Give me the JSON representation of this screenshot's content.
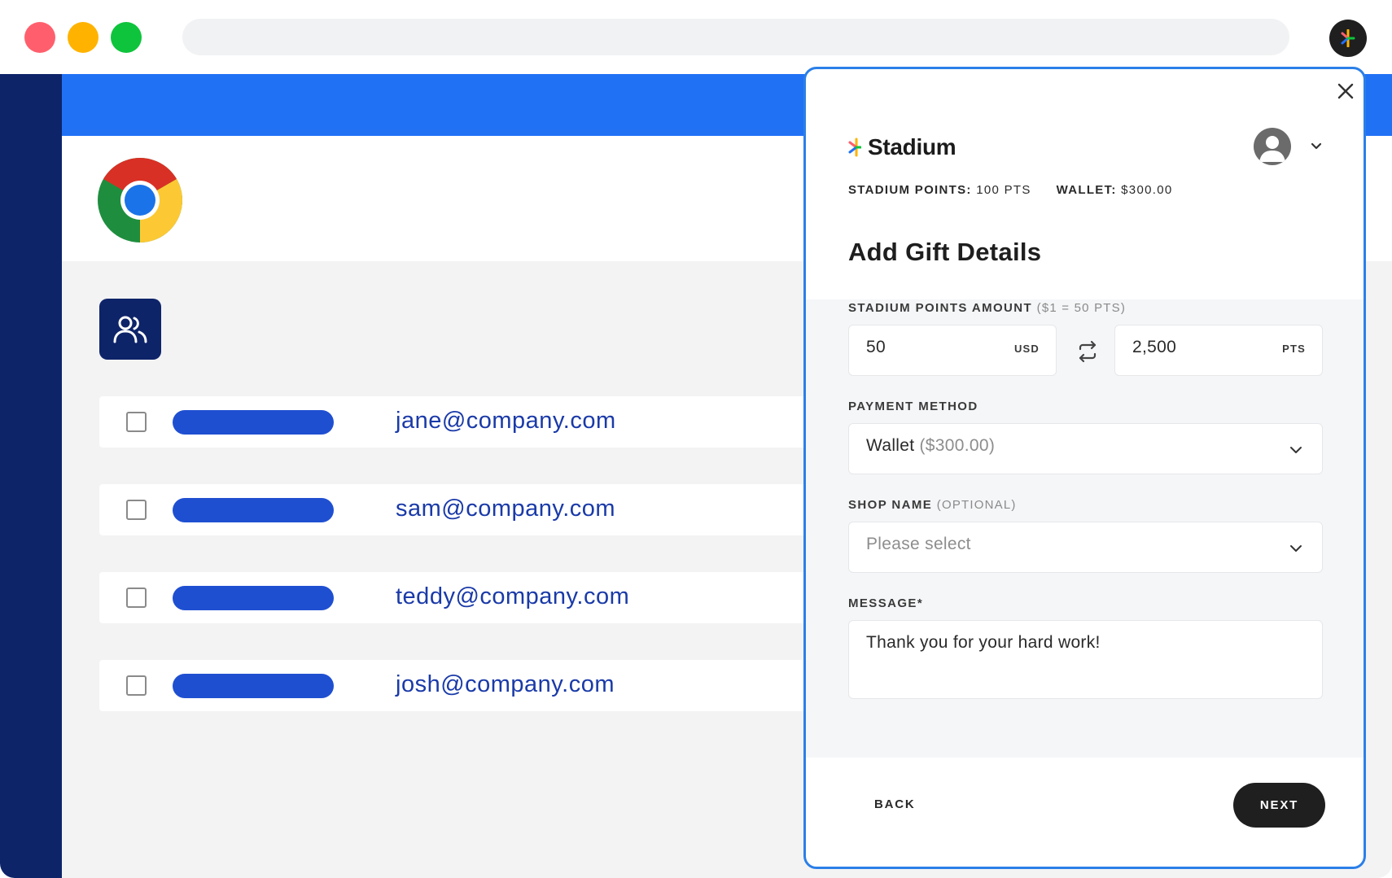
{
  "recipients": [
    {
      "email": "jane@company.com"
    },
    {
      "email": "sam@company.com"
    },
    {
      "email": "teddy@company.com"
    },
    {
      "email": "josh@company.com"
    }
  ],
  "panel": {
    "brand_name": "Stadium",
    "points_label": "STADIUM POINTS:",
    "points_value": "100 PTS",
    "wallet_label": "WALLET:",
    "wallet_value": "$300.00",
    "title": "Add Gift Details",
    "amount": {
      "label": "STADIUM POINTS AMOUNT",
      "hint": "($1 = 50 PTS)",
      "usd_value": "50",
      "usd_unit": "USD",
      "pts_value": "2,500",
      "pts_unit": "PTS"
    },
    "payment": {
      "label": "PAYMENT METHOD",
      "selected": "Wallet",
      "selected_detail": "($300.00)"
    },
    "shop": {
      "label": "SHOP NAME",
      "hint": "(OPTIONAL)",
      "placeholder": "Please select"
    },
    "message": {
      "label": "MESSAGE*",
      "value": "Thank you for your hard work!"
    },
    "back_label": "BACK",
    "next_label": "NEXT"
  },
  "colors": {
    "accent_blue": "#2171f5",
    "sidebar_navy": "#0e2469",
    "email_blue": "#1a3aa8",
    "pill_blue": "#1f4fd1",
    "panel_border": "#2b7fe8"
  },
  "icons": {
    "close": "close-icon",
    "users": "users-icon",
    "swap": "swap-arrows-icon",
    "chevron": "chevron-down-icon",
    "avatar": "user-avatar-icon",
    "logo": "stadium-logo-icon",
    "browser": "chrome-logo-icon"
  }
}
